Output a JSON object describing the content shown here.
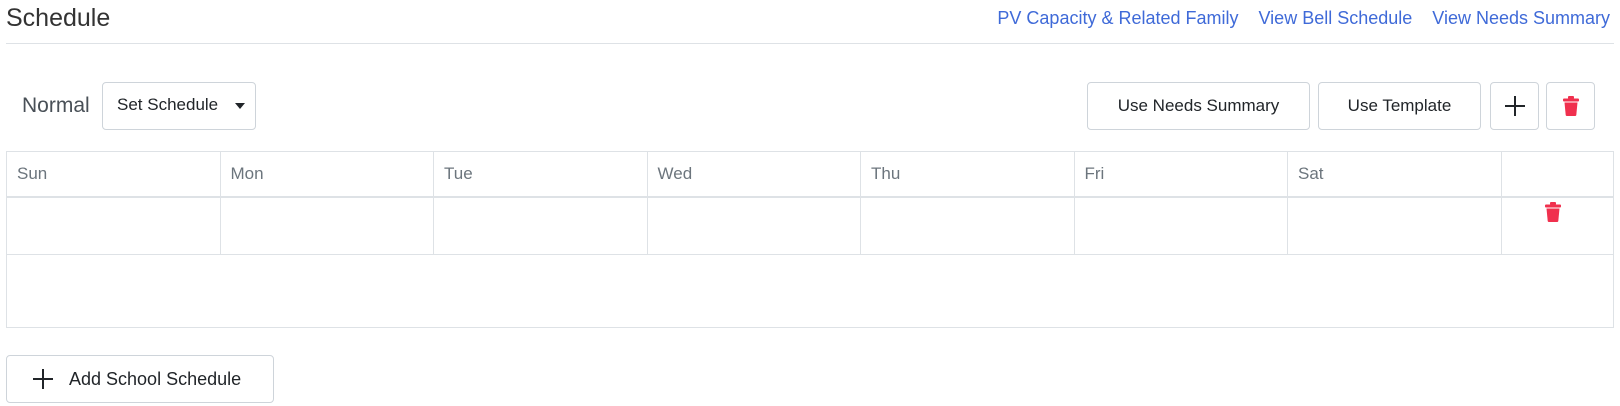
{
  "header": {
    "title": "Schedule",
    "links": [
      "PV Capacity & Related Family",
      "View Bell Schedule",
      "View Needs Summary"
    ]
  },
  "toolbar": {
    "mode_label": "Normal",
    "schedule_select_value": "Set Schedule",
    "use_needs_summary_label": "Use Needs Summary",
    "use_template_label": "Use Template"
  },
  "table": {
    "columns": [
      "Sun",
      "Mon",
      "Tue",
      "Wed",
      "Thu",
      "Fri",
      "Sat"
    ]
  },
  "footer": {
    "add_school_schedule_label": "Add School Schedule"
  },
  "colors": {
    "link": "#3f6ad8",
    "danger": "#f0304e"
  },
  "icons": {
    "add": "plus-icon",
    "delete": "trash-icon",
    "dropdown": "caret-down-icon"
  }
}
